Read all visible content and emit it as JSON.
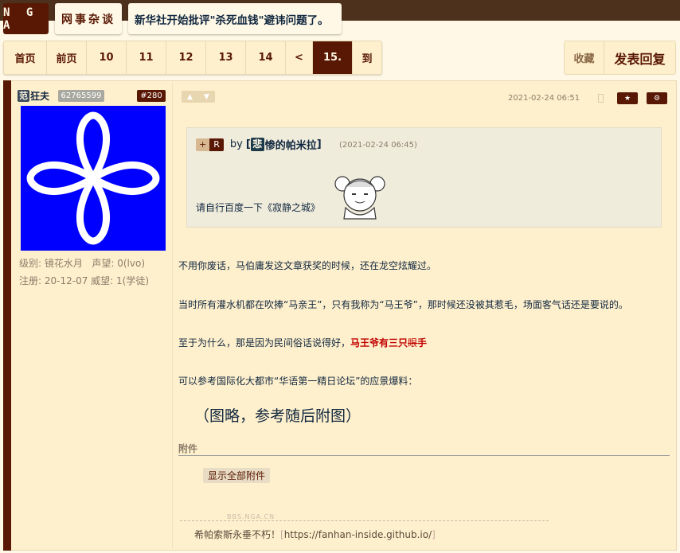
{
  "header": {
    "logo": "N G A",
    "forum": "网事杂谈",
    "thread_title": "新华社开始批评\"杀死血钱\"避讳问题了。"
  },
  "pager": {
    "first": "首页",
    "prev": "前页",
    "pages": [
      "10",
      "11",
      "12",
      "13",
      "14"
    ],
    "back": "<",
    "current": "15.",
    "goto": "到"
  },
  "actions": {
    "favorite": "收藏",
    "reply": "发表回复"
  },
  "user": {
    "mark": "范",
    "name": "狂夫",
    "uid": "62765599",
    "floor": "#280",
    "level_label": "级别:",
    "level": "镜花水月",
    "fame_label": "声望:",
    "fame": "0(lvo)",
    "reg_label": "注册:",
    "reg": "20-12-07",
    "prestige_label": "威望:",
    "prestige": "1(学徒)"
  },
  "post": {
    "date": "2021-02-24 06:51",
    "quote": {
      "badge_plus": "+",
      "badge_r": "R",
      "by": "by",
      "user_open": "[",
      "user_mark": "悲",
      "user_name": "惨的帕米拉",
      "user_close": "]",
      "date": "(2021-02-24 06:45)",
      "text": "请自行百度一下《寂静之城》"
    },
    "p1": "不用你废话，马伯庸发这文章获奖的时候，还在龙空炫耀过。",
    "p2": "当时所有灌水机都在吹捧“马亲王”，只有我称为“马王爷”，那时候还没被其惹毛，场面客气话还是要说的。",
    "p3_pre": "至于为什么，那是因为民间俗话说得好，",
    "p3_hl": "马王爷有三只",
    "p3_strike": "眼",
    "p3_post": "手",
    "p4": "可以参考国际化大都市“华语第一精日论坛”的应景爆料：",
    "big": "（图略，参考随后附图）",
    "attach_title": "附件",
    "attach_button": "显示全部附件",
    "watermark": "BBS.NGA.CN",
    "sig_pre": "希帕索斯永垂不朽！",
    "sig_open": "[",
    "sig_link": "https://fanhan-inside.github.io/",
    "sig_close": "]"
  },
  "colors": {
    "brand": "#591804",
    "background": "#fff8e7",
    "highlight": "#c00000",
    "avatar_bg": "#0000ff"
  },
  "icons": [
    "thumb-up-icon",
    "thumb-down-icon",
    "phone-icon",
    "star-icon",
    "gear-icon"
  ]
}
